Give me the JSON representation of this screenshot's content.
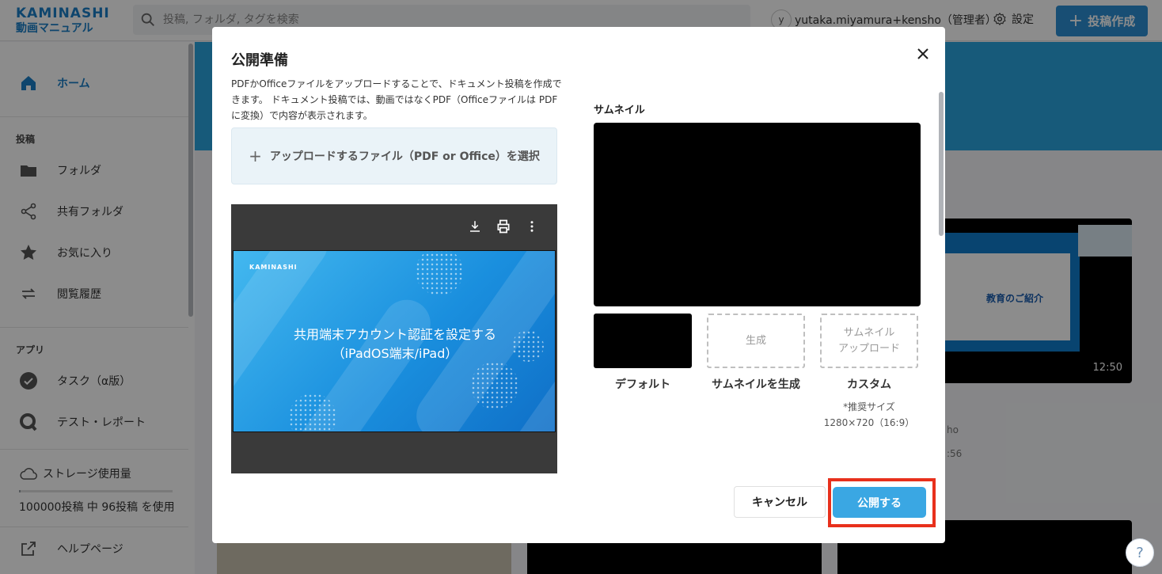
{
  "header": {
    "logo_line1": "KAMINASHI",
    "logo_line2": "動画マニュアル",
    "search_placeholder": "投稿, フォルダ, タグを検索",
    "user_initial": "y",
    "user_name": "yutaka.miyamura+kensho（管理者）",
    "settings_label": "設定",
    "new_post_label": "投稿作成",
    "accent_color": "#2d8fd4"
  },
  "sidebar": {
    "home": "ホーム",
    "section_posts": "投稿",
    "folder": "フォルダ",
    "shared_folder": "共有フォルダ",
    "favorites": "お気に入り",
    "history": "閲覧履歴",
    "section_apps": "アプリ",
    "tasks": "タスク（α版）",
    "test_report": "テスト・レポート",
    "storage_title": "ストレージ使用量",
    "storage_usage": "100000投稿 中 96投稿 を使用",
    "storage_fraction": 0.001,
    "help": "ヘルプページ"
  },
  "background": {
    "card_duration": "12:50",
    "card_slide_text": "教育のご紹介",
    "frag1": "ho",
    "frag2": ":56"
  },
  "modal": {
    "title": "公開準備",
    "description": "PDFかOfficeファイルをアップロードすることで、ドキュメント投稿を作成できます。 ドキュメント投稿では、動画ではなくPDF（Officeファイルは PDFに変換）で内容が表示されます。",
    "upload_label": "アップロードするファイル（PDF or Office）を選択",
    "slide_logo": "KAMINASHI",
    "slide_title_line1": "共用端末アカウント認証を設定する",
    "slide_title_line2": "（iPadOS端末/iPad）",
    "thumbnail_label": "サムネイル",
    "option_generate_box": "生成",
    "option_upload_box_line1": "サムネイル",
    "option_upload_box_line2": "アップロード",
    "caption_default": "デフォルト",
    "caption_generate": "サムネイルを生成",
    "caption_custom": "カスタム",
    "recommended_line1": "*推奨サイズ",
    "recommended_line2": "1280×720（16:9）",
    "cancel_label": "キャンセル",
    "publish_label": "公開する",
    "highlight_color": "#e8301c"
  }
}
